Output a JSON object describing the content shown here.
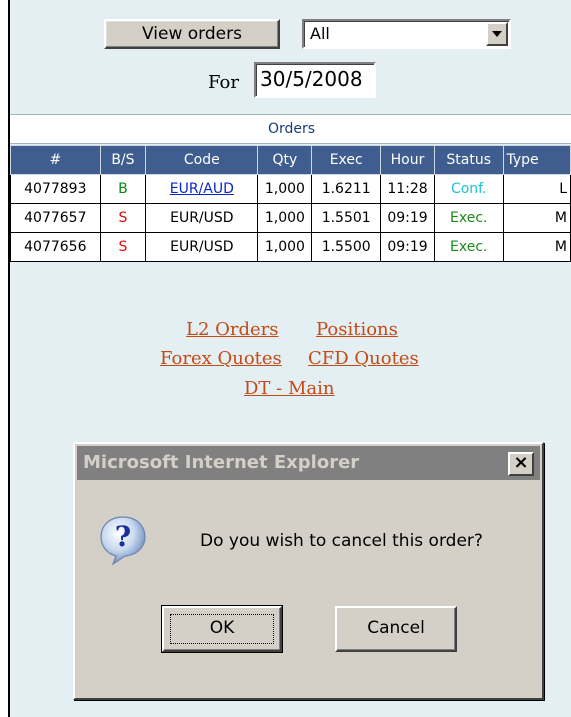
{
  "controls": {
    "view_orders_label": "View orders",
    "filter_value": "All",
    "for_label": "For",
    "date_value": "30/5/2008"
  },
  "orders": {
    "caption": "Orders",
    "columns": [
      "#",
      "B/S",
      "Code",
      "Qty",
      "Exec",
      "Hour",
      "Status",
      "Type"
    ],
    "rows": [
      {
        "id": "4077893",
        "bs": "B",
        "code": "EUR/AUD",
        "qty": "1,000",
        "exec": "1.6211",
        "hour": "11:28",
        "status": "Conf.",
        "type": "L"
      },
      {
        "id": "4077657",
        "bs": "S",
        "code": "EUR/USD",
        "qty": "1,000",
        "exec": "1.5501",
        "hour": "09:19",
        "status": "Exec.",
        "type": "M"
      },
      {
        "id": "4077656",
        "bs": "S",
        "code": "EUR/USD",
        "qty": "1,000",
        "exec": "1.5500",
        "hour": "09:19",
        "status": "Exec.",
        "type": "M"
      }
    ]
  },
  "links": {
    "l2_orders": "L2 Orders",
    "positions": "Positions",
    "forex_quotes": "Forex Quotes",
    "cfd_quotes": "CFD Quotes",
    "dt_main": "DT - Main"
  },
  "dialog": {
    "title": "Microsoft Internet Explorer",
    "close_glyph": "×",
    "message": "Do you wish to cancel this order?",
    "ok_label": "OK",
    "cancel_label": "Cancel",
    "icon": "question-icon"
  },
  "colors": {
    "background": "#e3eff3",
    "header_blue": "#3f5e8f",
    "buy": "#0a8a1a",
    "sell": "#e01010",
    "conf": "#19c3d6",
    "link": "#c44a14"
  }
}
